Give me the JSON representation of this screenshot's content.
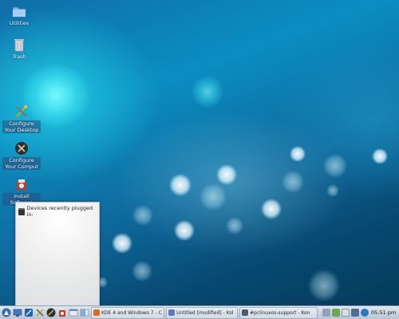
{
  "desktop": {
    "icons": [
      {
        "label": "Utilities",
        "icon": "folder-icon"
      },
      {
        "label": "Trash",
        "icon": "trash-icon"
      },
      {
        "label": "Configure Your Desktop",
        "icon": "configure-desktop-icon"
      },
      {
        "label": "Configure Your Comput",
        "icon": "configure-computer-icon"
      },
      {
        "label": "Install Software",
        "icon": "install-software-icon"
      }
    ]
  },
  "popup": {
    "title": "Devices recently plugged in:"
  },
  "taskbar": {
    "launchers": [
      "kde-menu-icon",
      "desktop-icon",
      "konqueror-icon",
      "settings-icon",
      "pclinuxos-control-icon",
      "software-icon",
      "file-manager-icon",
      "pager-icon"
    ],
    "tasks": [
      {
        "label": "KDE 4 and Windows 7 - C",
        "icon_color": "#d96c1b"
      },
      {
        "label": "Untitled [modified] - Kol",
        "icon_color": "#5a7bc4"
      },
      {
        "label": "#pclinuxos-support - Kon",
        "icon_color": "#4a5d6e"
      }
    ],
    "tray": [
      "network-icon",
      "battery-icon",
      "update-icon",
      "volume-icon",
      "info-icon"
    ],
    "clock": "05:51 pm"
  },
  "colors": {
    "taskbar_bg": "#c9d3de",
    "accent": "#0a8ec2"
  }
}
